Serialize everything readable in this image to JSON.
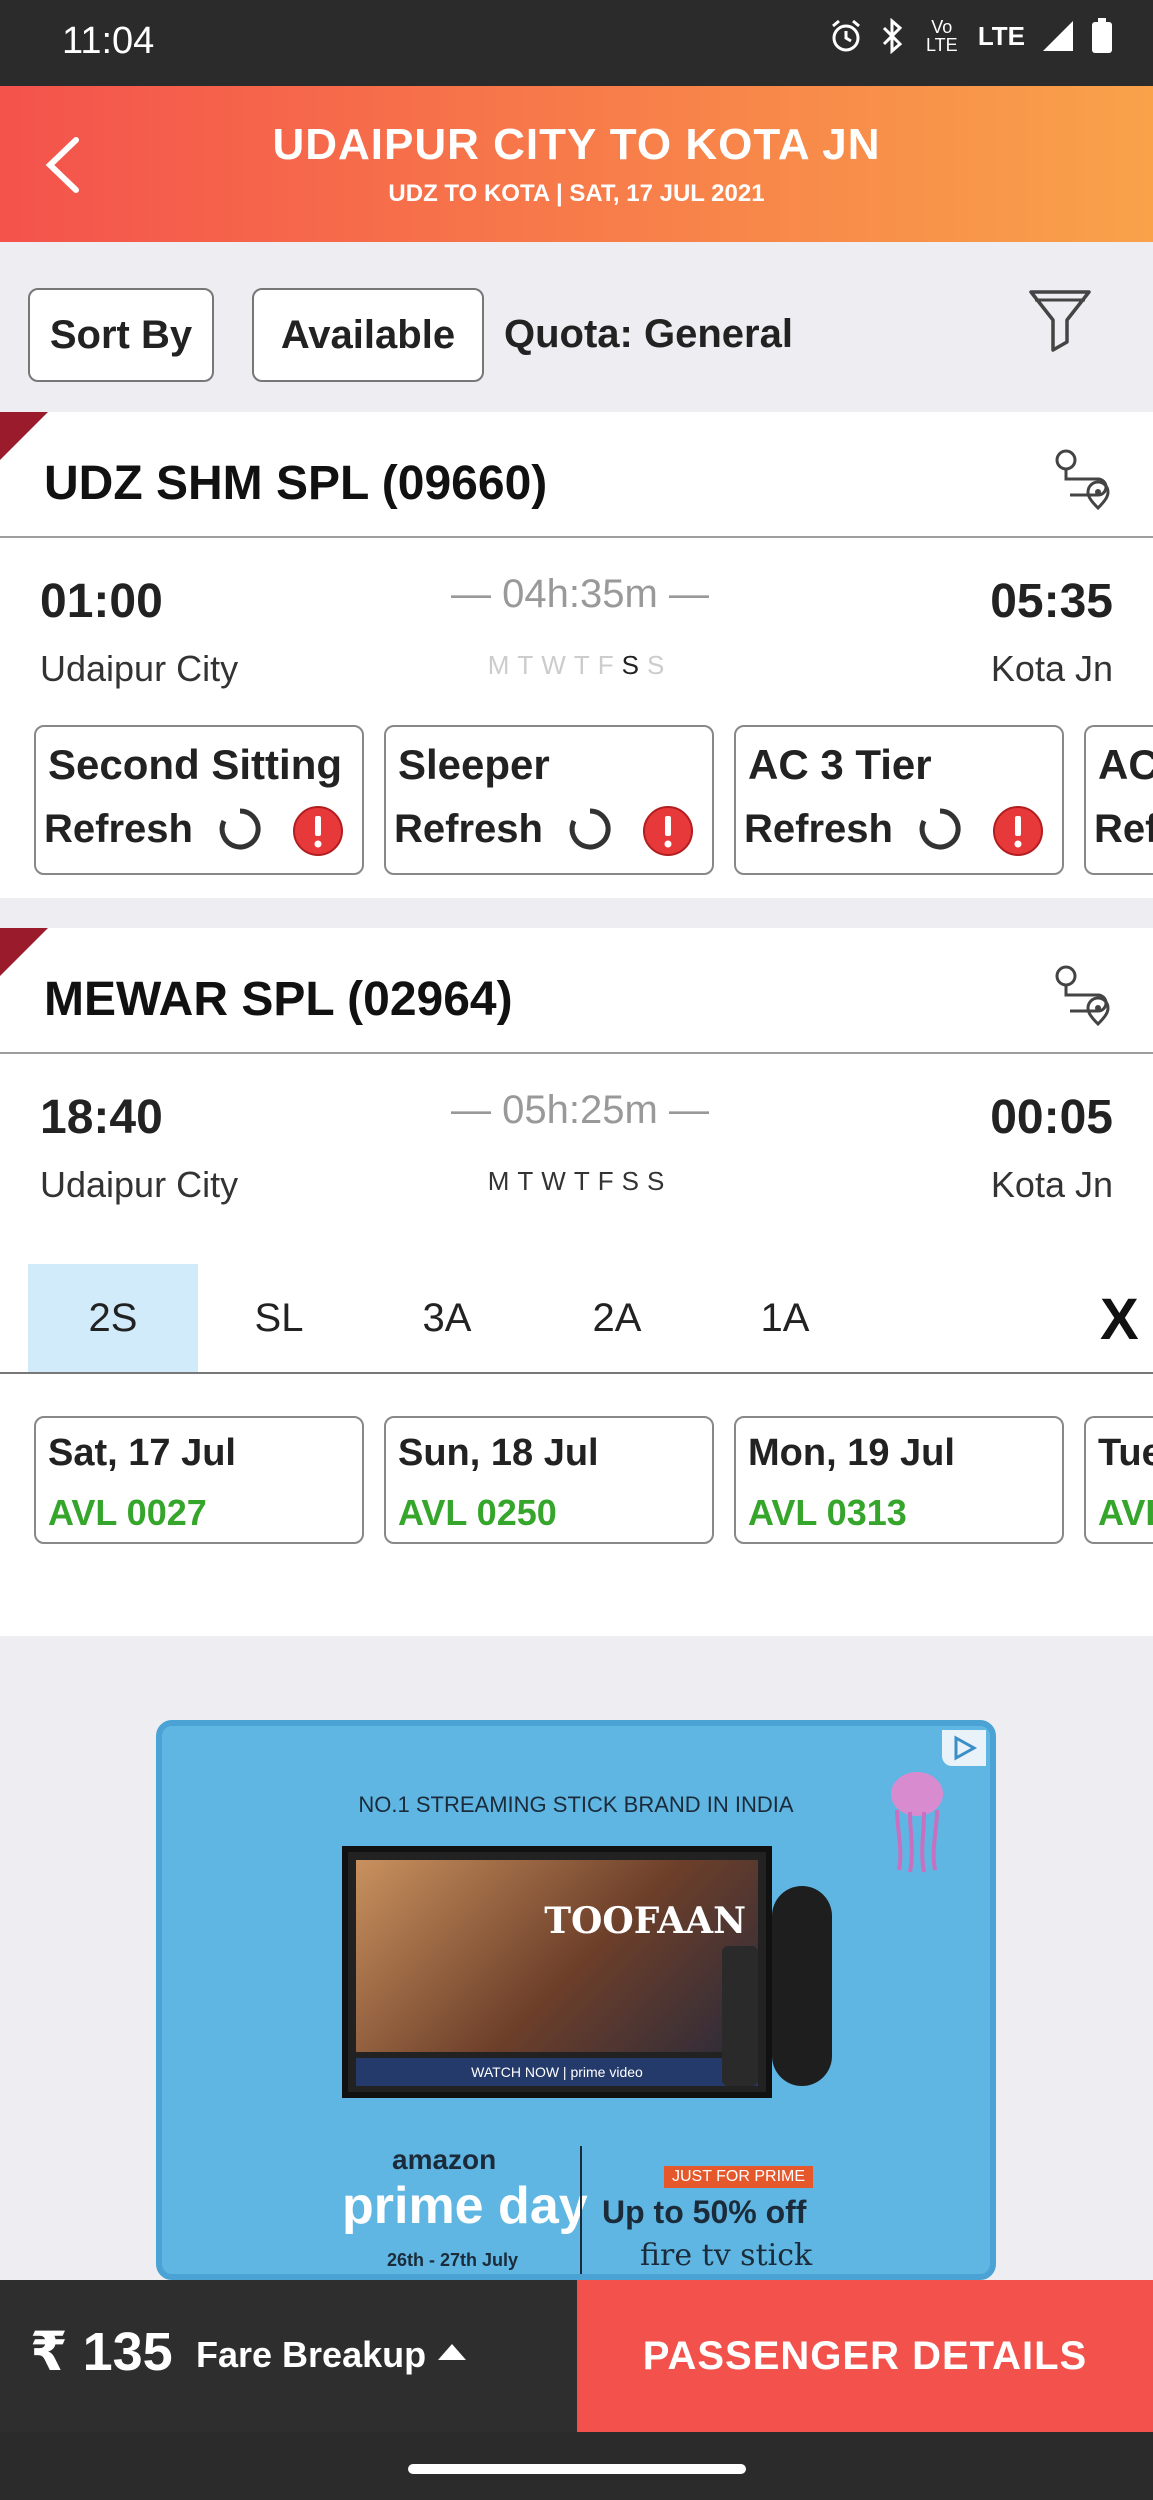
{
  "status_bar": {
    "time": "11:04",
    "network": "LTE",
    "volte": "Vo LTE"
  },
  "header": {
    "title": "UDAIPUR CITY TO KOTA JN",
    "subtitle": "UDZ TO KOTA | SAT, 17 JUL  2021"
  },
  "filters": {
    "sort_label": "Sort By",
    "available_label": "Available",
    "quota_label": "Quota:  General"
  },
  "trains": [
    {
      "name": "UDZ SHM SPL (09660)",
      "departure_time": "01:00",
      "arrival_time": "05:35",
      "from": "Udaipur City",
      "to": "Kota Jn",
      "duration": "04h:35m",
      "days": [
        "M",
        "T",
        "W",
        "T",
        "F",
        "S",
        "S"
      ],
      "classes": [
        {
          "name": "Second Sitting",
          "status": "Refresh"
        },
        {
          "name": "Sleeper",
          "status": "Refresh"
        },
        {
          "name": "AC 3 Tier",
          "status": "Refresh"
        },
        {
          "name": "AC",
          "status": "Ref"
        }
      ]
    },
    {
      "name": "MEWAR SPL (02964)",
      "departure_time": "18:40",
      "arrival_time": "00:05",
      "from": "Udaipur City",
      "to": "Kota Jn",
      "duration": "05h:25m",
      "days": [
        "M",
        "T",
        "W",
        "T",
        "F",
        "S",
        "S"
      ],
      "class_tabs": [
        "2S",
        "SL",
        "3A",
        "2A",
        "1A"
      ],
      "close_label": "X",
      "availability": [
        {
          "date": "Sat, 17 Jul",
          "avl": "AVL 0027"
        },
        {
          "date": "Sun, 18 Jul",
          "avl": "AVL 0250"
        },
        {
          "date": "Mon, 19 Jul",
          "avl": "AVL 0313"
        },
        {
          "date": "Tue",
          "avl": "AVL"
        }
      ]
    }
  ],
  "ad": {
    "headline": "NO.1 STREAMING STICK BRAND IN INDIA",
    "movie_title": "TOOFAAN",
    "tv_bar_text": "WATCH NOW | prime video",
    "brand_small": "amazon",
    "brand_big": "prime day",
    "dates": "26th - 27th July",
    "badge": "JUST FOR PRIME",
    "offer": "Up to 50% off",
    "product": "fire tv stick"
  },
  "footer": {
    "price": "₹ 135",
    "fare_breakup_label": "Fare Breakup",
    "passenger_button": "PASSENGER DETAILS"
  },
  "colors": {
    "accent": "#f2524b",
    "available_green": "#35a52b",
    "active_tab": "#d2ebfa",
    "corner_tag": "#9a1c2c"
  }
}
